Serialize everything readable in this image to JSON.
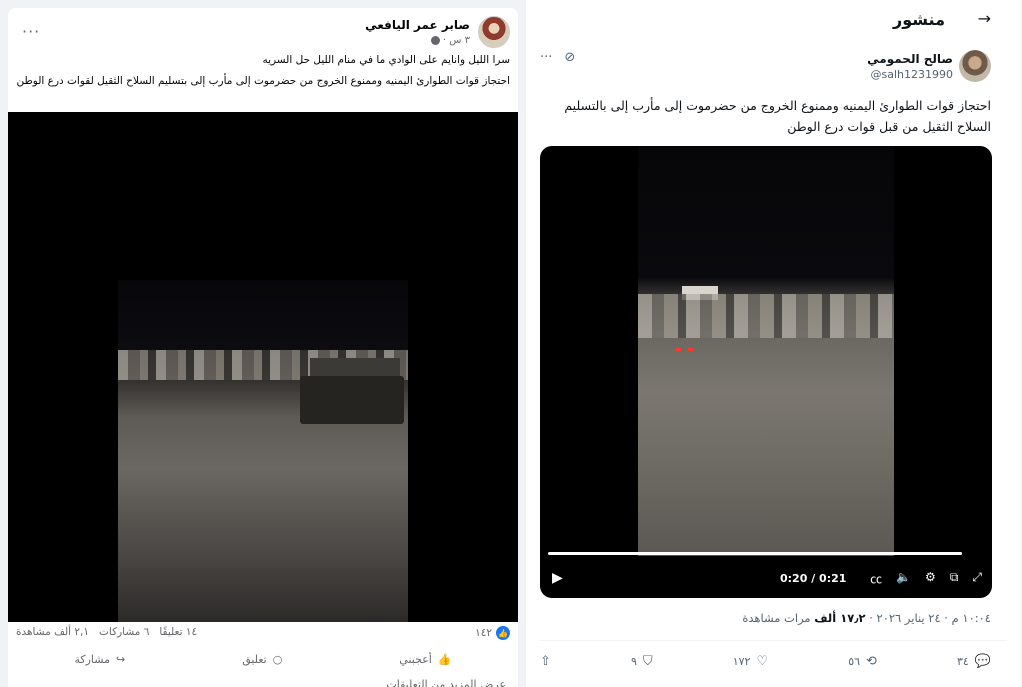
{
  "facebook": {
    "author_name": "صابر عمر اليافعي",
    "time": "٣ س ·",
    "line1": "سرا الليل وانايم على الوادي ما في منام الليل حل السريه",
    "line2": "احتجاز قوات الطوارئ اليمنيه وممنوع الخروج من حضرموت إلى مأرب  إلى بتسليم السلاح الثقيل  لقوات درع الوطن",
    "likes": "١٤٢",
    "comments": "١٤ تعليقًا",
    "shares": "٦ مشاركات",
    "views": "٢,١ ألف مشاهدة",
    "like_label": "أعجبني",
    "comment_label": "تعليق",
    "share_label": "مشاركة",
    "more_comments": "عرض المزيد من التعليقات",
    "more_glyph": "···",
    "mute_glyph": "🔇"
  },
  "x": {
    "page_title": "منشور",
    "back_glyph": "→",
    "author_name": "صالح الحمومي",
    "author_handle": "@salh1231990",
    "text": "احتجاز قوات الطوارئ اليمنيه وممنوع الخروج من حضرموت إلى مأرب  إلى بالتسليم السلاح الثقيل من قبل قوات درع الوطن",
    "video_time": "0:20 / 0:21",
    "video_progress": 0.95,
    "timestamp": "١٠:٠٤ م · ٢٤ يناير ٢٠٢٦ ·",
    "views_count": "١٧٫٢ ألف",
    "views_label": "مرات مشاهدة",
    "replies": "٣٤",
    "reposts": "٥٦",
    "likes": "١٧٢",
    "bookmarks": "٩",
    "more_glyph": "···",
    "grok_glyph": "⊘"
  }
}
